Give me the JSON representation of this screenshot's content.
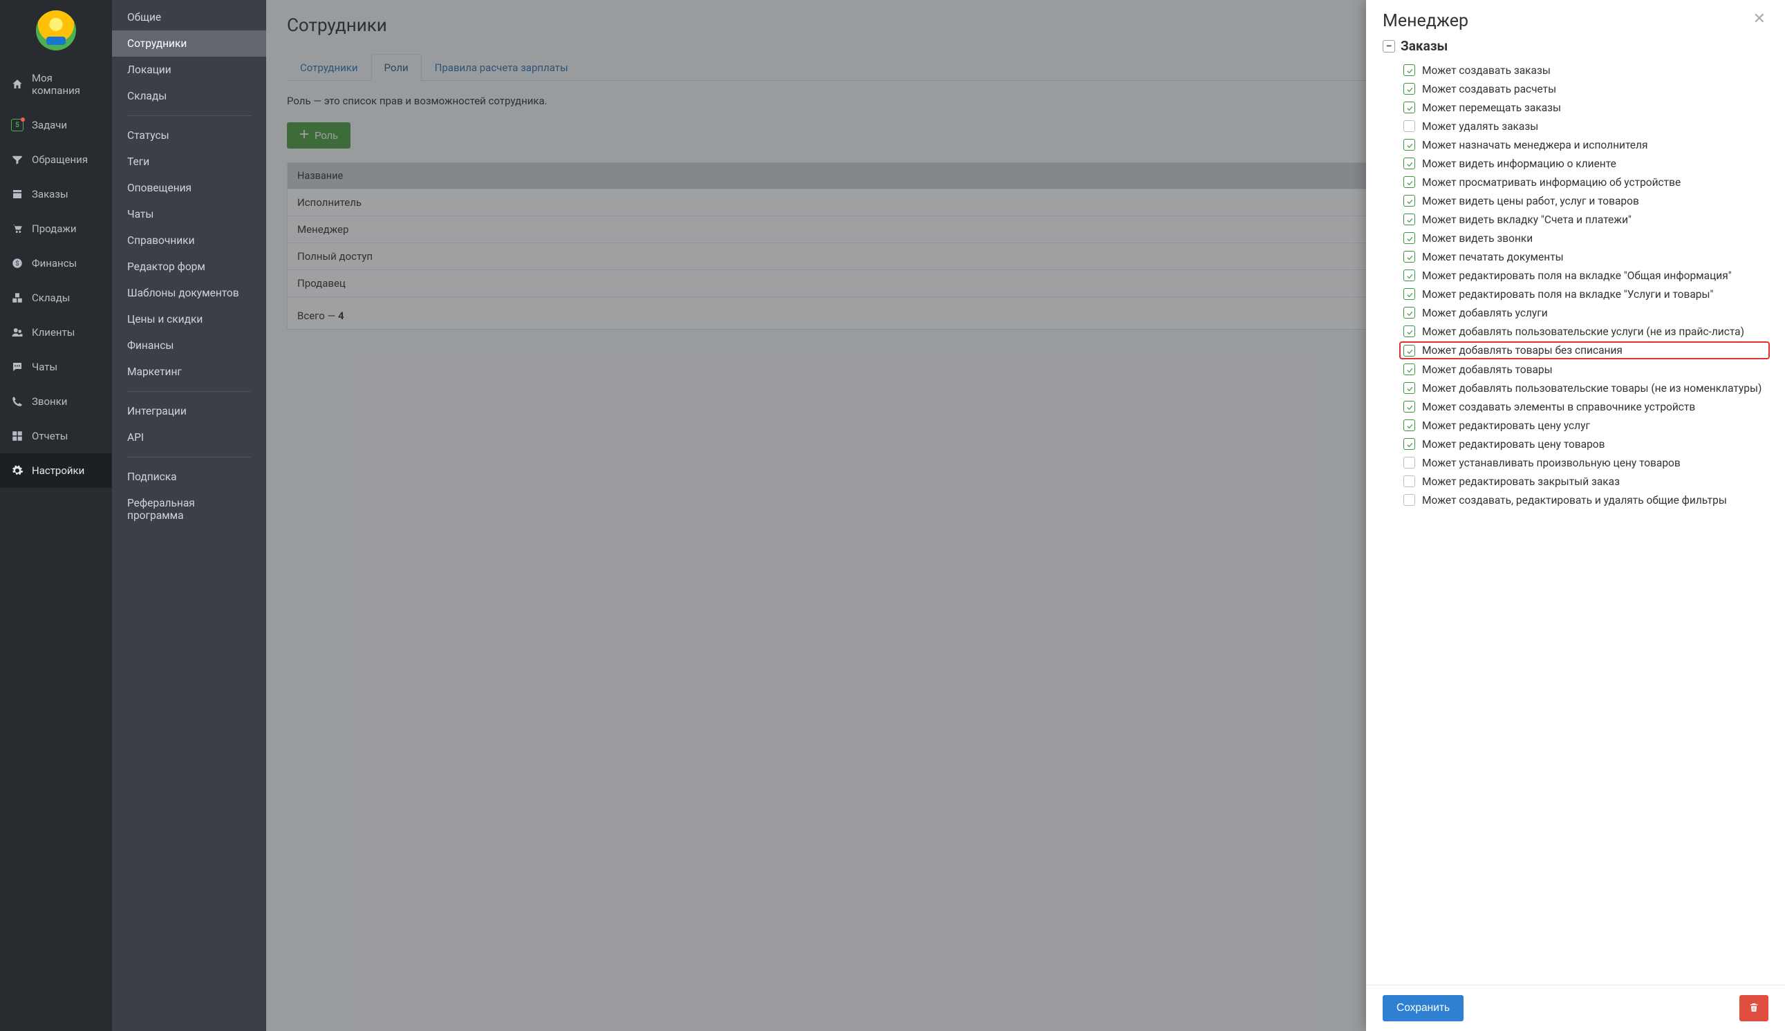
{
  "nav": {
    "items": [
      {
        "id": "company",
        "label": "Моя компания",
        "icon": "home"
      },
      {
        "id": "tasks",
        "label": "Задачи",
        "icon": "tasks",
        "badge": "5"
      },
      {
        "id": "leads",
        "label": "Обращения",
        "icon": "filter"
      },
      {
        "id": "orders",
        "label": "Заказы",
        "icon": "orders"
      },
      {
        "id": "sales",
        "label": "Продажи",
        "icon": "cart"
      },
      {
        "id": "finance",
        "label": "Финансы",
        "icon": "money"
      },
      {
        "id": "stock",
        "label": "Склады",
        "icon": "boxes"
      },
      {
        "id": "clients",
        "label": "Клиенты",
        "icon": "users"
      },
      {
        "id": "chats",
        "label": "Чаты",
        "icon": "chat"
      },
      {
        "id": "calls",
        "label": "Звонки",
        "icon": "phone"
      },
      {
        "id": "reports",
        "label": "Отчеты",
        "icon": "reports"
      },
      {
        "id": "settings",
        "label": "Настройки",
        "icon": "gear",
        "active": true
      }
    ]
  },
  "subnav": {
    "groups": [
      [
        "Общие",
        "Сотрудники",
        "Локации",
        "Склады"
      ],
      [
        "Статусы",
        "Теги",
        "Оповещения",
        "Чаты",
        "Справочники",
        "Редактор форм",
        "Шаблоны документов",
        "Цены и скидки",
        "Финансы",
        "Маркетинг"
      ],
      [
        "Интеграции",
        "API"
      ],
      [
        "Подписка",
        "Реферальная программа"
      ]
    ],
    "active": "Сотрудники"
  },
  "page": {
    "title": "Сотрудники",
    "tabs": [
      "Сотрудники",
      "Роли",
      "Правила расчета зарплаты"
    ],
    "active_tab": "Роли",
    "desc": "Роль — это список прав и возможностей сотрудника.",
    "add_role": "Роль",
    "table": {
      "header": "Название",
      "rows": [
        "Исполнитель",
        "Менеджер",
        "Полный доступ",
        "Продавец"
      ],
      "footer_prefix": "Всего — ",
      "footer_count": "4"
    }
  },
  "drawer": {
    "title": "Менеджер",
    "group": {
      "toggle": "−",
      "title": "Заказы"
    },
    "permissions": [
      {
        "label": "Может создавать заказы",
        "checked": true
      },
      {
        "label": "Может создавать расчеты",
        "checked": true
      },
      {
        "label": "Может перемещать заказы",
        "checked": true
      },
      {
        "label": "Может удалять заказы",
        "checked": false
      },
      {
        "label": "Может назначать менеджера и исполнителя",
        "checked": true
      },
      {
        "label": "Может видеть информацию о клиенте",
        "checked": true
      },
      {
        "label": "Может просматривать информацию об устройстве",
        "checked": true
      },
      {
        "label": "Может видеть цены работ, услуг и товаров",
        "checked": true
      },
      {
        "label": "Может видеть вкладку \"Счета и платежи\"",
        "checked": true
      },
      {
        "label": "Может видеть звонки",
        "checked": true
      },
      {
        "label": "Может печатать документы",
        "checked": true
      },
      {
        "label": "Может редактировать поля на вкладке \"Общая информация\"",
        "checked": true
      },
      {
        "label": "Может редактировать поля на вкладке \"Услуги и товары\"",
        "checked": true
      },
      {
        "label": "Может добавлять услуги",
        "checked": true
      },
      {
        "label": "Может добавлять пользовательские услуги (не из прайс-листа)",
        "checked": true
      },
      {
        "label": "Может добавлять товары без списания",
        "checked": true,
        "highlight": true
      },
      {
        "label": "Может добавлять товары",
        "checked": true
      },
      {
        "label": "Может добавлять пользовательские товары (не из номенклатуры)",
        "checked": true
      },
      {
        "label": "Может создавать элементы в справочнике устройств",
        "checked": true
      },
      {
        "label": "Может редактировать цену услуг",
        "checked": true
      },
      {
        "label": "Может редактировать цену товаров",
        "checked": true
      },
      {
        "label": "Может устанавливать произвольную цену товаров",
        "checked": false
      },
      {
        "label": "Может редактировать закрытый заказ",
        "checked": false
      },
      {
        "label": "Может создавать, редактировать и удалять общие фильтры",
        "checked": false
      }
    ],
    "save": "Сохранить"
  }
}
